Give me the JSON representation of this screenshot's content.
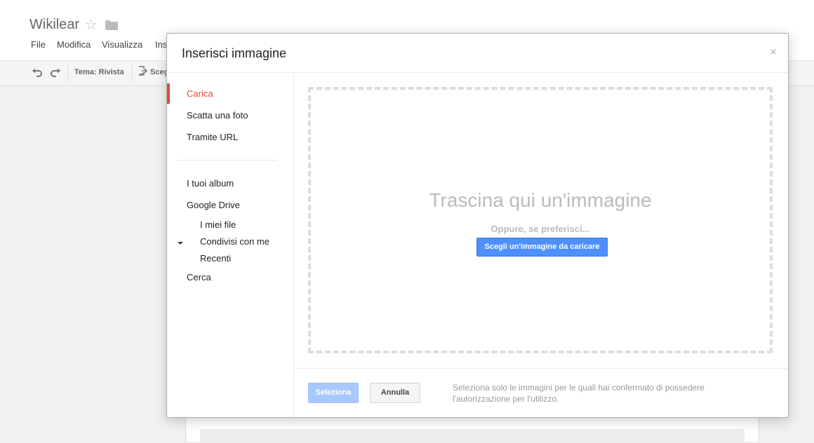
{
  "app": {
    "title": "Wikilear",
    "star_icon": "star-outline-icon",
    "folder_icon": "folder-icon"
  },
  "menubar": {
    "items": [
      "File",
      "Modifica",
      "Visualizza",
      "Ins"
    ]
  },
  "toolbar": {
    "undo_icon": "undo-icon",
    "redo_icon": "redo-icon",
    "theme_label": "Tema: Rivista",
    "choose_icon": "choose-theme-icon",
    "choose_label": "Sceg"
  },
  "dialog": {
    "title": "Inserisci immagine",
    "close_glyph": "×",
    "nav": {
      "upload": "Carica",
      "take_photo": "Scatta una foto",
      "by_url": "Tramite URL",
      "albums": "I tuoi album",
      "google_drive": "Google Drive",
      "my_files": "I miei file",
      "shared_with_me": "Condivisi con me",
      "recent": "Recenti",
      "search": "Cerca"
    },
    "dropzone": {
      "title": "Trascina qui un'immagine",
      "or_text": "Oppure, se preferisci...",
      "choose_button": "Scegli un'immagine da caricare"
    },
    "footer": {
      "select_button": "Seleziona",
      "cancel_button": "Annulla",
      "note": "Seleziona solo le immagini per le quali hai confermato di possedere l'autorizzazione per l'utilizzo."
    }
  },
  "colors": {
    "accent_red": "#dd4b39",
    "primary_blue": "#4d90fe",
    "disabled_blue": "#a8c8fb"
  }
}
